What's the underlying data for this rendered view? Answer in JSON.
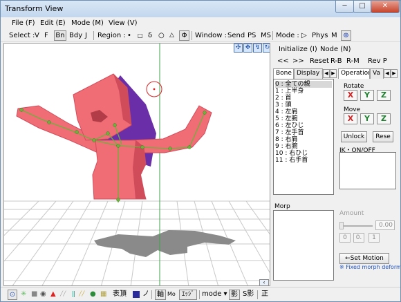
{
  "window": {
    "title": "Transform View",
    "min": "─",
    "max": "□",
    "close": "✕"
  },
  "menu": [
    "File (F)",
    "Edit (E)",
    "Mode (M)",
    "View (V)"
  ],
  "toolbar": {
    "select_label": "Select :",
    "select_items": [
      "V",
      "F",
      "Bn",
      "Bdy",
      "J"
    ],
    "region_label": "Region :",
    "region_icons": [
      "•",
      "□",
      "δ",
      "○",
      "△",
      "Φ"
    ],
    "window_label": "Window :",
    "window_items": [
      "Send",
      "PS",
      "MS"
    ],
    "mode_label": "Mode :",
    "mode_items": [
      "▷",
      "Phys",
      "M"
    ],
    "mode_icon": "⊕"
  },
  "viewport_icons": [
    "✣",
    "✥",
    "↯",
    "↻"
  ],
  "right": {
    "top_row": [
      "Initialize (I)",
      "Node (N)"
    ],
    "nav_row": [
      "<<",
      ">>",
      "Reset",
      "R-B",
      "R-M",
      "Rev P"
    ],
    "bone_tabs": [
      "Bone",
      "Display F"
    ],
    "op_tabs": [
      "Operation",
      "Va"
    ],
    "bones": [
      "0 : 全ての親",
      "1 : 上半身",
      "2 : 首",
      "3 : 頭",
      "4 : 左肩",
      "5 : 左腕",
      "6 : 左ひじ",
      "7 : 左手首",
      "8 : 右肩",
      "9 : 右腕",
      "10 : 右ひじ",
      "11 : 右手首"
    ],
    "rotate_label": "Rotate",
    "move_label": "Move",
    "axes": [
      "X",
      "Y",
      "Z"
    ],
    "unlock": "Unlock",
    "reset": "Rese",
    "ik_label": "IK・ON/OFF",
    "morp_label": "Morp",
    "amount_label": "Amount",
    "amount_value": "0.00",
    "amount_btns": [
      "0",
      "0.",
      "1"
    ],
    "set_motion": "←Set Motion",
    "fixed_note": "※ Fixed morph deform"
  },
  "bottom": {
    "icons": [
      "⊙",
      "✳",
      "■",
      "◉",
      "▲",
      "╱╱",
      "ǁ",
      "╱╱",
      "●",
      "▦"
    ],
    "kanji1": "表頂",
    "square_color": "#2b2a9a",
    "kanji2": "ノ",
    "axis": "軸",
    "mo": "Mo",
    "edge": "ｴｯｼﾞ",
    "mode": "mode ▾",
    "shadow": "影",
    "s_shadow": "S影",
    "seihou": "正"
  },
  "colors": {
    "model": "#f06d76",
    "model_dark": "#d14c5a",
    "purple": "#6a2fa8",
    "shadow": "#8a8a8a",
    "bone": "#6bb33b"
  }
}
